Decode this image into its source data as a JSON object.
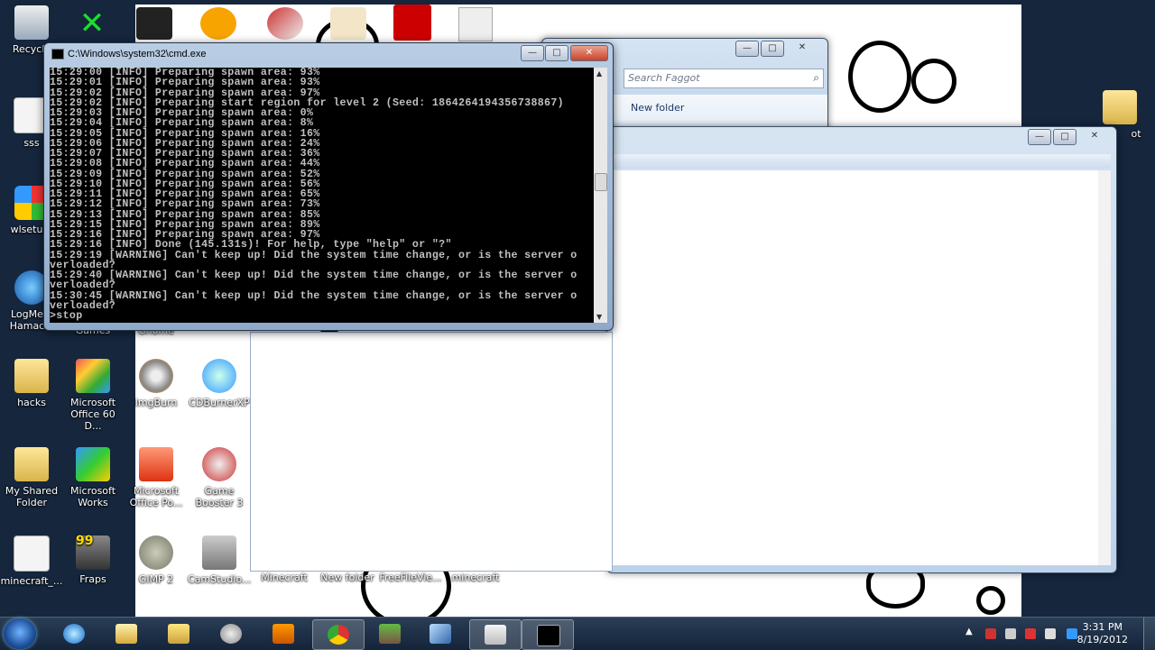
{
  "desktop_icons": [
    {
      "id": "recycle",
      "label": "Recycle"
    },
    {
      "id": "sss",
      "label": "sss"
    },
    {
      "id": "wlsetup",
      "label": "wlsetup-"
    },
    {
      "id": "logmein",
      "label": "LogMeIn Hamachi"
    },
    {
      "id": "hacks",
      "label": "hacks"
    },
    {
      "id": "office60",
      "label": "Microsoft Office 60 D..."
    },
    {
      "id": "imgburn",
      "label": "ImgBurn"
    },
    {
      "id": "cdburner",
      "label": "CDBurnerXP"
    },
    {
      "id": "shared",
      "label": "My Shared Folder"
    },
    {
      "id": "works",
      "label": "Microsoft Works"
    },
    {
      "id": "officepo",
      "label": "Microsoft Office Po..."
    },
    {
      "id": "gamebooster",
      "label": "Game Booster 3"
    },
    {
      "id": "minecraft_jar",
      "label": "minecraft_..."
    },
    {
      "id": "fraps",
      "label": "Fraps"
    },
    {
      "id": "gimp",
      "label": "GIMP 2"
    },
    {
      "id": "camstudio",
      "label": "CamStudio..."
    },
    {
      "id": "minecraft",
      "label": "Minecraft"
    },
    {
      "id": "newfolder",
      "label": "New folder"
    },
    {
      "id": "freefile",
      "label": "FreeFileVie..."
    },
    {
      "id": "minecraft2",
      "label": "minecraft"
    },
    {
      "id": "games",
      "label": "Games"
    },
    {
      "id": "gnome",
      "label": "Gnome"
    },
    {
      "id": "ot",
      "label": "ot"
    },
    {
      "id": "wlsetup_edge",
      "label": ""
    }
  ],
  "cmd": {
    "title": "C:\\Windows\\system32\\cmd.exe",
    "lines": [
      "15:29:00 [INFO] Preparing spawn area: 93%",
      "15:29:01 [INFO] Preparing spawn area: 93%",
      "15:29:02 [INFO] Preparing spawn area: 97%",
      "15:29:02 [INFO] Preparing start region for level 2 (Seed: 1864264194356738867)",
      "15:29:03 [INFO] Preparing spawn area: 0%",
      "15:29:04 [INFO] Preparing spawn area: 8%",
      "15:29:05 [INFO] Preparing spawn area: 16%",
      "15:29:06 [INFO] Preparing spawn area: 24%",
      "15:29:07 [INFO] Preparing spawn area: 36%",
      "15:29:08 [INFO] Preparing spawn area: 44%",
      "15:29:09 [INFO] Preparing spawn area: 52%",
      "15:29:10 [INFO] Preparing spawn area: 56%",
      "15:29:11 [INFO] Preparing spawn area: 65%",
      "15:29:12 [INFO] Preparing spawn area: 73%",
      "15:29:13 [INFO] Preparing spawn area: 85%",
      "15:29:15 [INFO] Preparing spawn area: 89%",
      "15:29:16 [INFO] Preparing spawn area: 97%",
      "15:29:16 [INFO] Done (145.131s)! For help, type \"help\" or \"?\"",
      "15:29:19 [WARNING] Can't keep up! Did the system time change, or is the server o",
      "verloaded?",
      "15:29:40 [WARNING] Can't keep up! Did the system time change, or is the server o",
      "verloaded?",
      "15:30:45 [WARNING] Can't keep up! Did the system time change, or is the server o",
      "verloaded?",
      ">stop"
    ]
  },
  "explorer_back": {
    "search_placeholder": "Search Faggot",
    "new_folder": "New folder"
  },
  "taskbar": {
    "time": "3:31 PM",
    "date": "8/19/2012",
    "apps": [
      "start",
      "ie",
      "explorer",
      "folder",
      "webcam",
      "media",
      "chrome",
      "minecraft",
      "paint",
      "explorer-window",
      "cmd"
    ]
  }
}
